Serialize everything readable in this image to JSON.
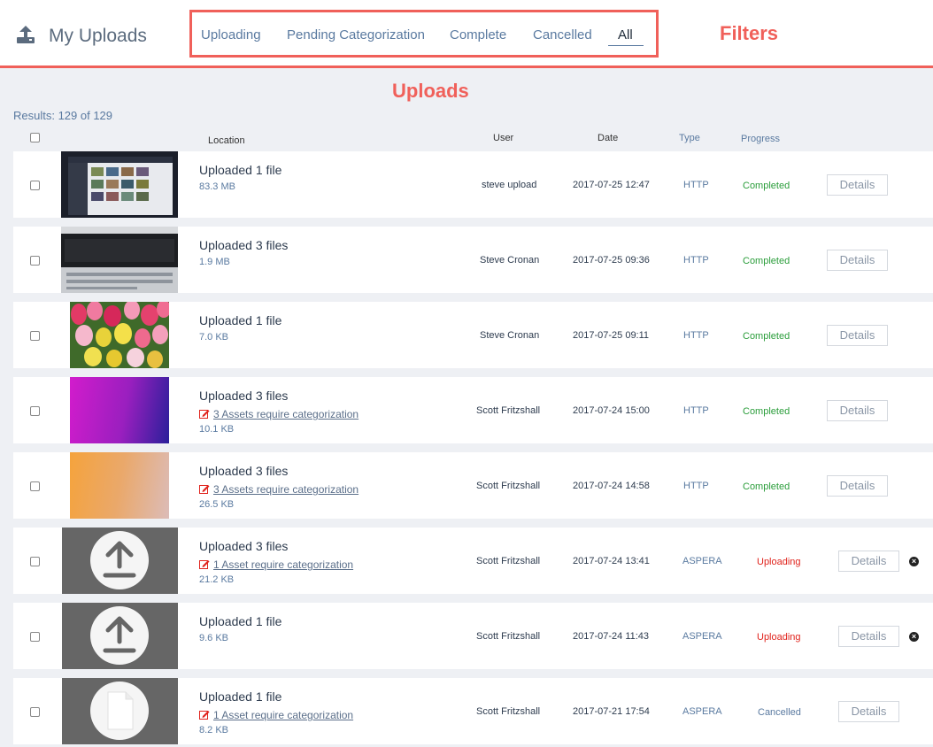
{
  "header": {
    "title": "My Uploads",
    "icon": "upload-icon"
  },
  "filters": {
    "tabs": [
      {
        "label": "Uploading",
        "active": false
      },
      {
        "label": "Pending Categorization",
        "active": false
      },
      {
        "label": "Complete",
        "active": false
      },
      {
        "label": "Cancelled",
        "active": false
      },
      {
        "label": "All",
        "active": true
      }
    ]
  },
  "annotations": {
    "filters": "Filters",
    "uploads": "Uploads"
  },
  "results": "Results: 129 of 129",
  "columns": {
    "location": "Location",
    "user": "User",
    "date": "Date",
    "type": "Type",
    "progress": "Progress"
  },
  "colors": {
    "accent": "#f0605a",
    "completed": "#2a9d3a",
    "uploading": "#e0231c",
    "cancelled": "#5a7aa0"
  },
  "rows": [
    {
      "title": "Uploaded 1 file",
      "link": "",
      "size": "83.3 MB",
      "user": "steve upload",
      "date": "2017-07-25 12:47",
      "type": "HTTP",
      "progress": "Completed",
      "details": "Details",
      "thumb": "screenshot-thumbnail"
    },
    {
      "title": "Uploaded 3 files",
      "link": "",
      "size": "1.9 MB",
      "user": "Steve Cronan",
      "date": "2017-07-25 09:36",
      "type": "HTTP",
      "progress": "Completed",
      "details": "Details",
      "thumb": "dark-screenshot-thumbnail"
    },
    {
      "title": "Uploaded 1 file",
      "link": "",
      "size": "7.0 KB",
      "user": "Steve Cronan",
      "date": "2017-07-25 09:11",
      "type": "HTTP",
      "progress": "Completed",
      "details": "Details",
      "thumb": "tulips-thumbnail"
    },
    {
      "title": "Uploaded 3 files",
      "link": "3 Assets require categorization",
      "size": "10.1 KB",
      "user": "Scott Fritzshall",
      "date": "2017-07-24 15:00",
      "type": "HTTP",
      "progress": "Completed",
      "details": "Details",
      "thumb": "purple-gradient-thumbnail"
    },
    {
      "title": "Uploaded 3 files",
      "link": "3 Assets require categorization",
      "size": "26.5 KB",
      "user": "Scott Fritzshall",
      "date": "2017-07-24 14:58",
      "type": "HTTP",
      "progress": "Completed",
      "details": "Details",
      "thumb": "orange-gradient-thumbnail"
    },
    {
      "title": "Uploaded 3 files",
      "link": "1 Asset require categorization",
      "size": "21.2 KB",
      "user": "Scott Fritzshall",
      "date": "2017-07-24 13:41",
      "type": "ASPERA",
      "progress": "Uploading",
      "details": "Details",
      "thumb": "upload-placeholder-thumbnail"
    },
    {
      "title": "Uploaded 1 file",
      "link": "",
      "size": "9.6 KB",
      "user": "Scott Fritzshall",
      "date": "2017-07-24 11:43",
      "type": "ASPERA",
      "progress": "Uploading",
      "details": "Details",
      "thumb": "upload-placeholder-thumbnail"
    },
    {
      "title": "Uploaded 1 file",
      "link": "1 Asset require categorization",
      "size": "8.2 KB",
      "user": "Scott Fritzshall",
      "date": "2017-07-21 17:54",
      "type": "ASPERA",
      "progress": "Cancelled",
      "details": "Details",
      "thumb": "file-placeholder-thumbnail"
    }
  ]
}
